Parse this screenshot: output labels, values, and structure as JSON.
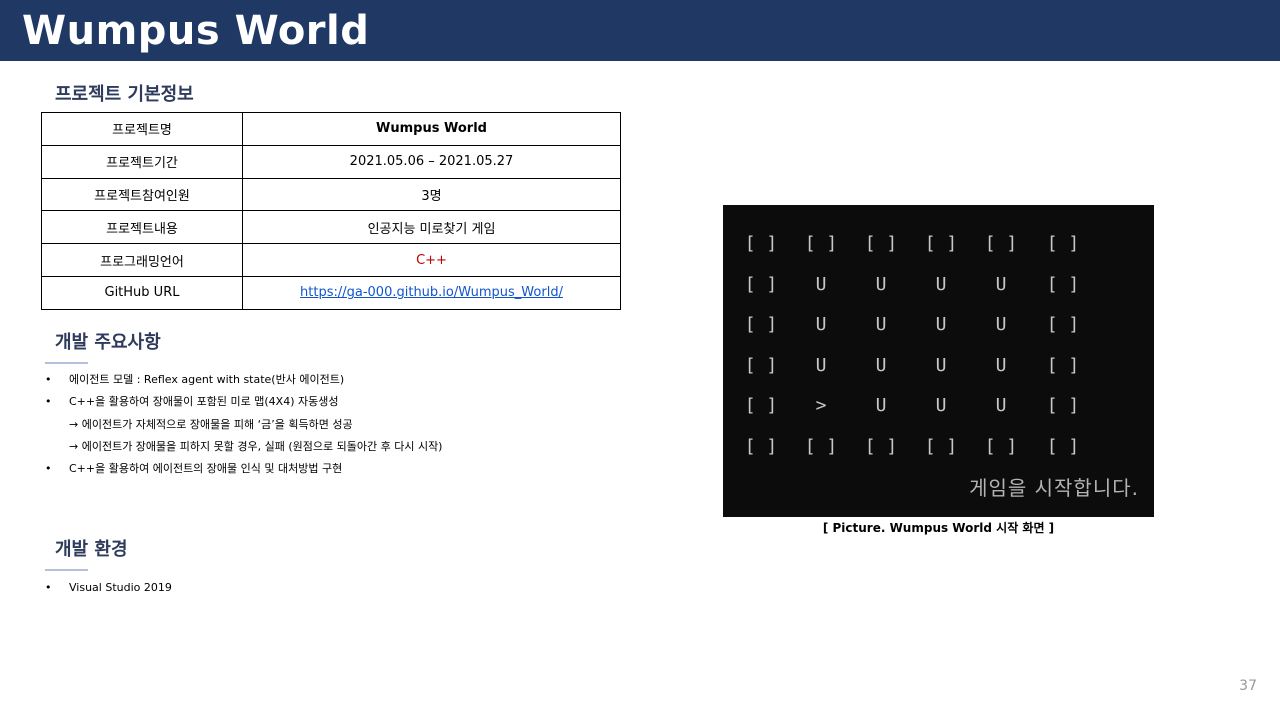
{
  "header": {
    "title": "Wumpus World"
  },
  "project_info": {
    "heading": "프로젝트 기본정보",
    "rows": [
      {
        "label": "프로젝트명",
        "value": "Wumpus World"
      },
      {
        "label": "프로젝트기간",
        "value": "2021.05.06 – 2021.05.27"
      },
      {
        "label": "프로젝트참여인원",
        "value": "3명"
      },
      {
        "label": "프로젝트내용",
        "value": "인공지능 미로찾기 게임"
      },
      {
        "label": "프로그래밍언어",
        "value": "C++"
      },
      {
        "label": "GitHub URL",
        "value": "https://ga-000.github.io/Wumpus_World/"
      }
    ]
  },
  "dev_points": {
    "heading": "개발 주요사항",
    "bullet_glyph": "•",
    "items": [
      "에이전트 모델 : Reflex agent with state(반사 에이전트)",
      "C++을 활용하여 장애물이 포함된 미로 맵(4X4) 자동생성",
      "→ 에이전트가 자체적으로 장애물을 피해 ‘금’을 획득하면 성공",
      "→ 에이전트가 장애물을 피하지 못할 경우, 실패 (원점으로 되돌아간 후 다시 시작)",
      "C++을 활용하여 에이전트의 장애물 인식 및 대처방법 구현"
    ]
  },
  "dev_env": {
    "heading": "개발 환경",
    "items": [
      "Visual Studio 2019"
    ]
  },
  "screenshot": {
    "grid": [
      [
        "[ ]",
        "[ ]",
        "[ ]",
        "[ ]",
        "[ ]",
        "[ ]"
      ],
      [
        "[ ]",
        "U",
        "U",
        "U",
        "U",
        "[ ]"
      ],
      [
        "[ ]",
        "U",
        "U",
        "U",
        "U",
        "[ ]"
      ],
      [
        "[ ]",
        "U",
        "U",
        "U",
        "U",
        "[ ]"
      ],
      [
        "[ ]",
        ">",
        "U",
        "U",
        "U",
        "[ ]"
      ],
      [
        "[ ]",
        "[ ]",
        "[ ]",
        "[ ]",
        "[ ]",
        "[ ]"
      ]
    ],
    "message": "게임을 시작합니다.",
    "caption": "[ Picture. Wumpus World 시작 화면 ]"
  },
  "page_number": "37",
  "colors": {
    "header_bg": "#1f3864",
    "accent_red": "#c00000",
    "link": "#1155cc",
    "terminal_bg": "#0c0c0c"
  }
}
